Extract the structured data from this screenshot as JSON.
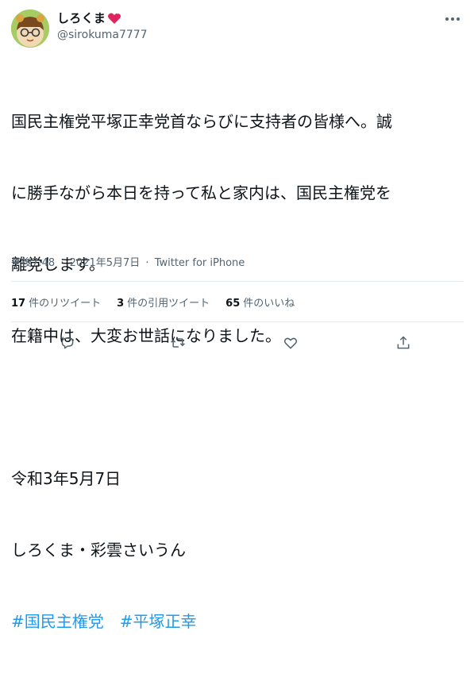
{
  "user": {
    "display_name": "しろくま",
    "handle": "@sirokuma7777",
    "badge_icon": "heart-icon",
    "badge_color": "#e0245e"
  },
  "tweet": {
    "lines": [
      "国民主権党平塚正幸党首ならびに支持者の皆様へ。誠",
      "に勝手ながら本日を持って私と家内は、国民主権党を",
      "離党します。",
      "在籍中は、大変お世話になりました。",
      "",
      "令和3年5月7日",
      "しろくま・彩雲さいうん"
    ],
    "hashtags": [
      "#国民主権党",
      "#平塚正幸"
    ]
  },
  "meta": {
    "time": "午後7:48",
    "separator": "·",
    "date": "2021年5月7日",
    "source": "Twitter for iPhone"
  },
  "stats": [
    {
      "count": "17",
      "label": "件のリツイート"
    },
    {
      "count": "3",
      "label": "件の引用ツイート"
    },
    {
      "count": "65",
      "label": "件のいいね"
    }
  ],
  "actions": [
    "reply-icon",
    "retweet-icon",
    "like-icon",
    "share-icon"
  ],
  "colors": {
    "accent": "#1d9bf0",
    "text": "#0f1419",
    "muted": "#536471"
  }
}
